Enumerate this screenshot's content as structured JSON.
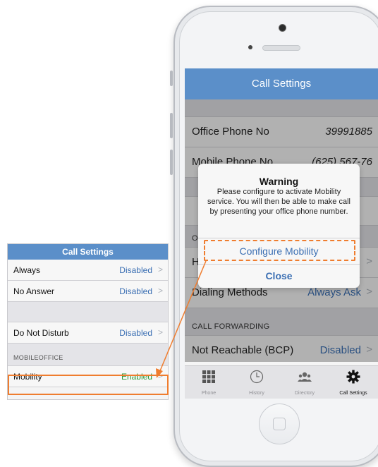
{
  "phone": {
    "nav_title": "Call Settings",
    "rows": [
      {
        "label": "Office Phone No",
        "value": "39991885"
      },
      {
        "label": "Mobile Phone No",
        "value": "(625) 567-76"
      }
    ],
    "partial_label_o": "O",
    "partial_label_h": "H",
    "dialing_label": "Dialing Methods",
    "dialing_value": "Always Ask",
    "section_forwarding": "CALL FORWARDING",
    "not_reachable": {
      "label": "Not Reachable (BCP)",
      "value": "Disabled"
    },
    "tabs": [
      {
        "label": "Phone",
        "icon": "keypad-icon"
      },
      {
        "label": "History",
        "icon": "clock-icon"
      },
      {
        "label": "Directory",
        "icon": "people-icon"
      },
      {
        "label": "Call Settings",
        "icon": "gear-icon"
      }
    ]
  },
  "alert": {
    "title": "Warning",
    "message": "Please configure to activate Mobility service. You will then be able to make call by presenting your office phone number.",
    "primary_button": "Configure Mobility",
    "secondary_button": "Close"
  },
  "panel": {
    "title": "Call Settings",
    "rows_top": [
      {
        "label": "Always",
        "value": "Disabled"
      },
      {
        "label": "No Answer",
        "value": "Disabled"
      }
    ],
    "dnd": {
      "label": "Do Not Disturb",
      "value": "Disabled"
    },
    "section": "MOBILEOFFICE",
    "mobility": {
      "label": "Mobility",
      "value": "Enabled"
    }
  },
  "colors": {
    "accent": "#5b8fc9",
    "highlight": "#ef7d2f",
    "link": "#3b6fb3",
    "enabled": "#2a9a3a"
  }
}
